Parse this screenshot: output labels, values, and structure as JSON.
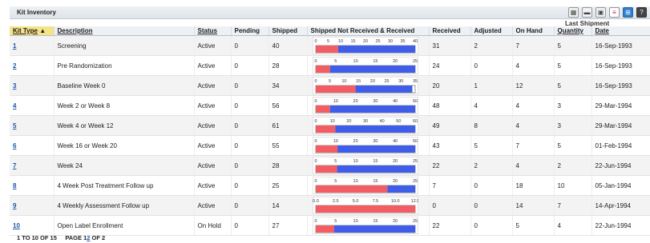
{
  "title": "Kit Inventory",
  "toolbar": {
    "icons": [
      "columns-icon",
      "minimize-icon",
      "image-icon",
      "pdf-icon",
      "excel-icon",
      "help-icon"
    ]
  },
  "last_shipment_label": "Last Shipment",
  "columns": {
    "kit_type": "Kit Type",
    "description": "Description",
    "status": "Status",
    "pending": "Pending",
    "shipped": "Shipped",
    "chart": "Shipped Not Received & Received",
    "received": "Received",
    "adjusted": "Adjusted",
    "on_hand": "On Hand",
    "quantity": "Quantity",
    "date": "Date"
  },
  "rows": [
    {
      "kit_type": "1",
      "description": "Screening",
      "status": "Active",
      "pending": "0",
      "shipped": "40",
      "received": "31",
      "adjusted": "2",
      "on_hand": "7",
      "quantity": "5",
      "date": "16-Sep-1993",
      "ticks": [
        "0",
        "5",
        "10",
        "15",
        "20",
        "25",
        "30",
        "35",
        "40"
      ],
      "scale_max": 40,
      "shipped_not_received": 9,
      "received_value": 31
    },
    {
      "kit_type": "2",
      "description": "Pre Randomization",
      "status": "Active",
      "pending": "0",
      "shipped": "28",
      "received": "24",
      "adjusted": "0",
      "on_hand": "4",
      "quantity": "5",
      "date": "16-Sep-1993",
      "ticks": [
        "0",
        "5",
        "10",
        "15",
        "20",
        "25"
      ],
      "scale_max": 28,
      "shipped_not_received": 4,
      "received_value": 24
    },
    {
      "kit_type": "3",
      "description": "Baseline  Week 0",
      "status": "Active",
      "pending": "0",
      "shipped": "34",
      "received": "20",
      "adjusted": "1",
      "on_hand": "12",
      "quantity": "5",
      "date": "16-Sep-1993",
      "ticks": [
        "0",
        "5",
        "10",
        "15",
        "20",
        "25",
        "30",
        "35"
      ],
      "scale_max": 35,
      "shipped_not_received": 14,
      "received_value": 20
    },
    {
      "kit_type": "4",
      "description": "Week 2 or Week 8",
      "status": "Active",
      "pending": "0",
      "shipped": "56",
      "received": "48",
      "adjusted": "4",
      "on_hand": "4",
      "quantity": "3",
      "date": "29-Mar-1994",
      "ticks": [
        "0",
        "10",
        "20",
        "30",
        "40",
        "50"
      ],
      "scale_max": 56,
      "shipped_not_received": 8,
      "received_value": 48
    },
    {
      "kit_type": "5",
      "description": "Week 4 or Week 12",
      "status": "Active",
      "pending": "0",
      "shipped": "61",
      "received": "49",
      "adjusted": "8",
      "on_hand": "4",
      "quantity": "3",
      "date": "29-Mar-1994",
      "ticks": [
        "0",
        "10",
        "20",
        "30",
        "40",
        "50",
        "60"
      ],
      "scale_max": 61,
      "shipped_not_received": 12,
      "received_value": 49
    },
    {
      "kit_type": "6",
      "description": "Week 16 or Week 20",
      "status": "Active",
      "pending": "0",
      "shipped": "55",
      "received": "43",
      "adjusted": "5",
      "on_hand": "7",
      "quantity": "5",
      "date": "01-Feb-1994",
      "ticks": [
        "0",
        "10",
        "20",
        "30",
        "40",
        "50"
      ],
      "scale_max": 55,
      "shipped_not_received": 12,
      "received_value": 43
    },
    {
      "kit_type": "7",
      "description": "Week 24",
      "status": "Active",
      "pending": "0",
      "shipped": "28",
      "received": "22",
      "adjusted": "2",
      "on_hand": "4",
      "quantity": "2",
      "date": "22-Jun-1994",
      "ticks": [
        "0",
        "5",
        "10",
        "15",
        "20",
        "25"
      ],
      "scale_max": 28,
      "shipped_not_received": 6,
      "received_value": 22
    },
    {
      "kit_type": "8",
      "description": "4 Week Post Treatment Follow up",
      "status": "Active",
      "pending": "0",
      "shipped": "25",
      "received": "7",
      "adjusted": "0",
      "on_hand": "18",
      "quantity": "10",
      "date": "05-Jan-1994",
      "ticks": [
        "0",
        "5",
        "10",
        "15",
        "20",
        "25"
      ],
      "scale_max": 25,
      "shipped_not_received": 18,
      "received_value": 7
    },
    {
      "kit_type": "9",
      "description": "4 Weekly Assessment Follow up",
      "status": "Active",
      "pending": "0",
      "shipped": "14",
      "received": "0",
      "adjusted": "0",
      "on_hand": "14",
      "quantity": "7",
      "date": "14-Apr-1994",
      "ticks": [
        "0.0",
        "2.5",
        "5.0",
        "7.5",
        "10.0",
        "12.5"
      ],
      "scale_max": 14,
      "shipped_not_received": 14,
      "received_value": 0
    },
    {
      "kit_type": "10",
      "description": "Open Label Enrollment",
      "status": "On Hold",
      "pending": "0",
      "shipped": "27",
      "received": "22",
      "adjusted": "0",
      "on_hand": "5",
      "quantity": "4",
      "date": "22-Jun-1994",
      "ticks": [
        "0",
        "5",
        "10",
        "15",
        "20",
        "25"
      ],
      "scale_max": 27,
      "shipped_not_received": 5,
      "received_value": 22
    }
  ],
  "footer": {
    "range": "1 TO 10 OF 15",
    "page_prefix": "PAGE ",
    "page_first": "1",
    "page_current": "2",
    "page_suffix": " OF 2"
  },
  "colors": {
    "shipped_not_received": "#f25d63",
    "received": "#3f5de8",
    "sorted_header": "#f5e38a",
    "link": "#1a55a8"
  }
}
